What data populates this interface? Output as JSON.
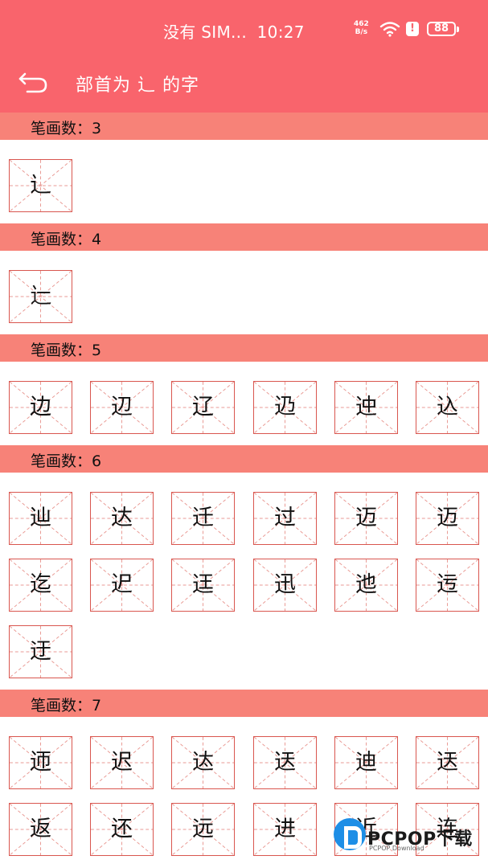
{
  "status_bar": {
    "carrier": "没有 SIM...",
    "time": "10:27",
    "net_speed_value": "462",
    "net_speed_unit": "B/s",
    "battery": "88",
    "alert_glyph": "!",
    "icons": [
      "wifi-icon",
      "alert-icon",
      "battery-icon"
    ]
  },
  "header": {
    "title": "部首为 辶 的字",
    "back_icon": "back-arrow-icon"
  },
  "sections": [
    {
      "label": "笔画数：3",
      "chars": [
        "辶"
      ]
    },
    {
      "label": "笔画数：4",
      "chars": [
        "辷"
      ]
    },
    {
      "label": "笔画数：5",
      "chars": [
        "边",
        "辺",
        "辽",
        "辸",
        "迚",
        "込"
      ]
    },
    {
      "label": "笔画数：6",
      "chars": [
        "辿",
        "达",
        "迁",
        "过",
        "迈",
        "迈",
        "迄",
        "迉",
        "迋",
        "迅",
        "迆",
        "迃",
        "迂"
      ]
    },
    {
      "label": "笔画数：7",
      "chars": [
        "迊",
        "迟",
        "迏",
        "迗",
        "迪",
        "迗",
        "返",
        "还",
        "远",
        "进",
        "近",
        "连"
      ]
    }
  ],
  "watermark": {
    "brand": "PCPOP下载",
    "sub": "PCPOP Download"
  },
  "colors": {
    "header_bg": "#f9646c",
    "section_bg": "#f78278",
    "grid_border": "#d9564f",
    "grid_guide": "#e99a94",
    "watermark_blue": "#1d8ee6"
  }
}
